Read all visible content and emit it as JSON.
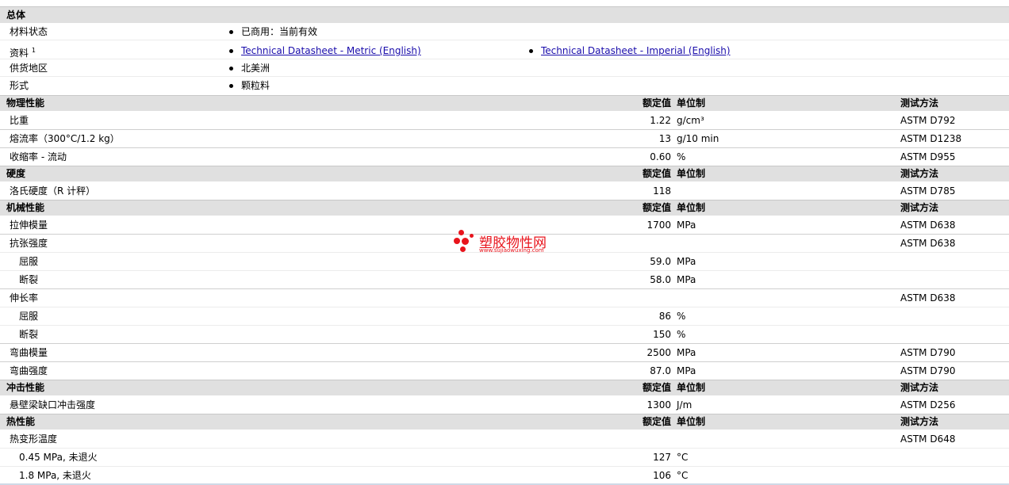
{
  "general": {
    "section_title": "总体",
    "rows": {
      "status": {
        "label": "材料状态",
        "value": "已商用：当前有效"
      },
      "docs": {
        "label": "资料",
        "sup": "1",
        "link_metric": "Technical Datasheet - Metric (English)",
        "link_imperial": "Technical Datasheet - Imperial (English)"
      },
      "region": {
        "label": "供货地区",
        "value": "北美洲"
      },
      "form": {
        "label": "形式",
        "value": "颗粒料"
      }
    }
  },
  "columns": {
    "value": "额定值",
    "unit": "单位制",
    "test": "测试方法"
  },
  "physical": {
    "section_title": "物理性能",
    "rows": {
      "sg": {
        "label": "比重",
        "value": "1.22",
        "unit": "g/cm³",
        "test": "ASTM D792"
      },
      "mfr": {
        "label": "熔流率（300°C/1.2 kg）",
        "value": "13",
        "unit": "g/10 min",
        "test": "ASTM D1238"
      },
      "shrink": {
        "label": "收缩率 - 流动",
        "value": "0.60",
        "unit": "%",
        "test": "ASTM D955"
      }
    }
  },
  "hardness": {
    "section_title": "硬度",
    "rows": {
      "rockwell": {
        "label": "洛氏硬度（R 计秤）",
        "value": "118",
        "unit": "",
        "test": "ASTM D785"
      }
    }
  },
  "mechanical": {
    "section_title": "机械性能",
    "rows": {
      "tmod": {
        "label": "拉伸模量",
        "value": "1700",
        "unit": "MPa",
        "test": "ASTM D638"
      },
      "tstr": {
        "label": "抗张强度",
        "test": "ASTM D638"
      },
      "tstr_yield": {
        "label": "屈服",
        "value": "59.0",
        "unit": "MPa"
      },
      "tstr_break": {
        "label": "断裂",
        "value": "58.0",
        "unit": "MPa"
      },
      "elong": {
        "label": "伸长率",
        "test": "ASTM D638"
      },
      "elong_yield": {
        "label": "屈服",
        "value": "86",
        "unit": "%"
      },
      "elong_break": {
        "label": "断裂",
        "value": "150",
        "unit": "%"
      },
      "fmod": {
        "label": "弯曲模量",
        "value": "2500",
        "unit": "MPa",
        "test": "ASTM D790"
      },
      "fstr": {
        "label": "弯曲强度",
        "value": "87.0",
        "unit": "MPa",
        "test": "ASTM D790"
      }
    }
  },
  "impact": {
    "section_title": "冲击性能",
    "rows": {
      "izod": {
        "label": "悬壁梁缺口冲击强度",
        "value": "1300",
        "unit": "J/m",
        "test": "ASTM D256"
      }
    }
  },
  "thermal": {
    "section_title": "热性能",
    "rows": {
      "hdt": {
        "label": "热变形温度",
        "test": "ASTM D648"
      },
      "hdt_045": {
        "label": "0.45 MPa, 未退火",
        "value": "127",
        "unit": "°C"
      },
      "hdt_18": {
        "label": "1.8 MPa, 未退火",
        "value": "106",
        "unit": "°C"
      }
    }
  },
  "watermark": {
    "title": "塑胶物性网",
    "url": "www.sujiaowuxing.com",
    "color": "#e8141c"
  }
}
